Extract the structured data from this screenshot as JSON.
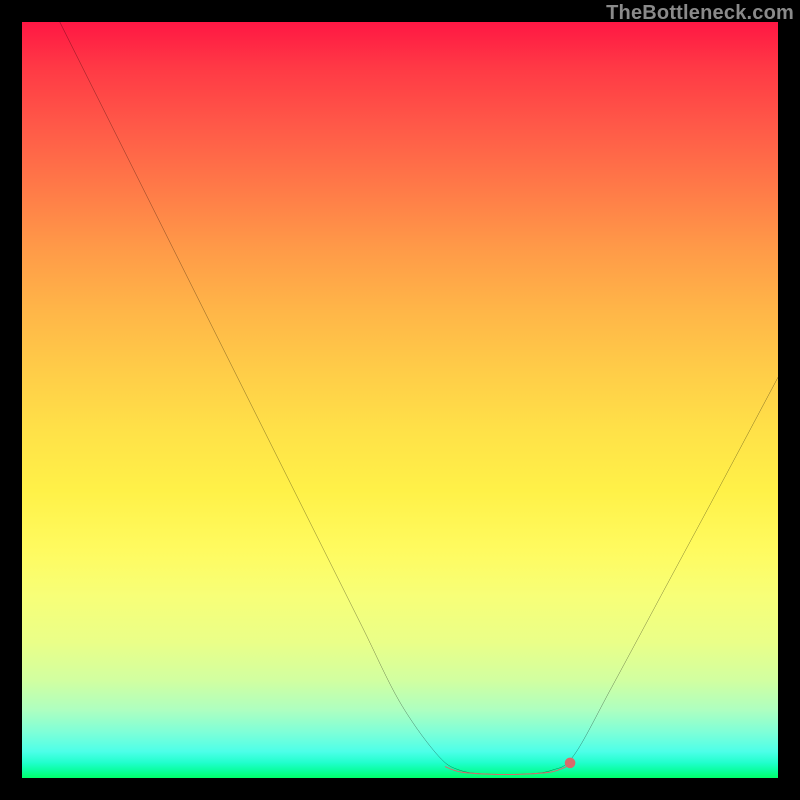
{
  "watermark": "TheBottleneck.com",
  "chart_data": {
    "type": "line",
    "title": "",
    "xlabel": "",
    "ylabel": "",
    "xlim": [
      0,
      100
    ],
    "ylim": [
      0,
      100
    ],
    "grid": false,
    "legend": false,
    "annotations": [],
    "background": "vertical heat gradient red→yellow→green",
    "series": [
      {
        "name": "bottleneck-curve",
        "stroke": "#000000",
        "points": [
          {
            "x": 5,
            "y": 100
          },
          {
            "x": 10,
            "y": 90
          },
          {
            "x": 15,
            "y": 80
          },
          {
            "x": 20,
            "y": 70
          },
          {
            "x": 25,
            "y": 60
          },
          {
            "x": 30,
            "y": 50
          },
          {
            "x": 35,
            "y": 40
          },
          {
            "x": 40,
            "y": 30
          },
          {
            "x": 45,
            "y": 20
          },
          {
            "x": 50,
            "y": 10
          },
          {
            "x": 55,
            "y": 3
          },
          {
            "x": 58,
            "y": 1
          },
          {
            "x": 62,
            "y": 0.5
          },
          {
            "x": 66,
            "y": 0.5
          },
          {
            "x": 70,
            "y": 1
          },
          {
            "x": 73,
            "y": 3
          },
          {
            "x": 78,
            "y": 12
          },
          {
            "x": 85,
            "y": 25
          },
          {
            "x": 92,
            "y": 38
          },
          {
            "x": 100,
            "y": 53
          }
        ]
      },
      {
        "name": "flat-bottom-highlight",
        "stroke": "#d86b6b",
        "stroke_width": 6,
        "points": [
          {
            "x": 56,
            "y": 1.5
          },
          {
            "x": 58,
            "y": 0.8
          },
          {
            "x": 62,
            "y": 0.5
          },
          {
            "x": 66,
            "y": 0.5
          },
          {
            "x": 70,
            "y": 0.8
          },
          {
            "x": 72,
            "y": 1.5
          }
        ]
      },
      {
        "name": "highlight-endpoint",
        "type": "point",
        "fill": "#d86b6b",
        "points": [
          {
            "x": 72.5,
            "y": 2
          }
        ]
      }
    ]
  }
}
